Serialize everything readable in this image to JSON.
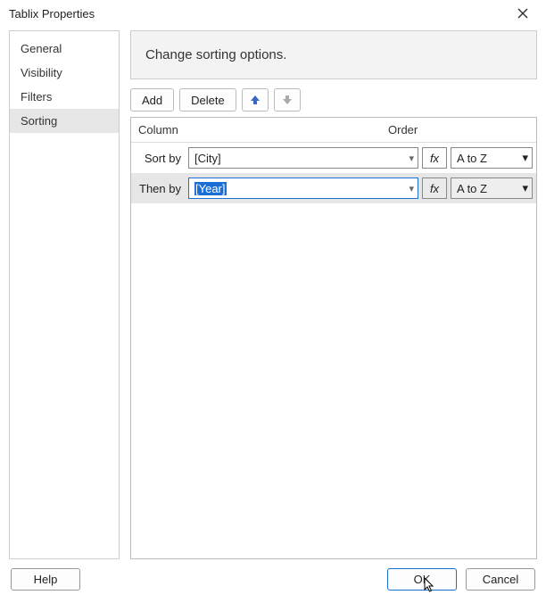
{
  "title": "Tablix Properties",
  "sidebar": {
    "items": [
      {
        "label": "General",
        "selected": false
      },
      {
        "label": "Visibility",
        "selected": false
      },
      {
        "label": "Filters",
        "selected": false
      },
      {
        "label": "Sorting",
        "selected": true
      }
    ]
  },
  "heading": "Change sorting options.",
  "toolbar": {
    "add": "Add",
    "delete": "Delete"
  },
  "grid": {
    "col_column": "Column",
    "col_order": "Order",
    "rows": [
      {
        "label": "Sort by",
        "value": "[City]",
        "order": "A to Z",
        "selected": false,
        "highlighted": false
      },
      {
        "label": "Then by",
        "value": "[Year]",
        "order": "A to Z",
        "selected": true,
        "highlighted": true
      }
    ]
  },
  "fx_label": "fx",
  "footer": {
    "help": "Help",
    "ok": "OK",
    "cancel": "Cancel"
  }
}
